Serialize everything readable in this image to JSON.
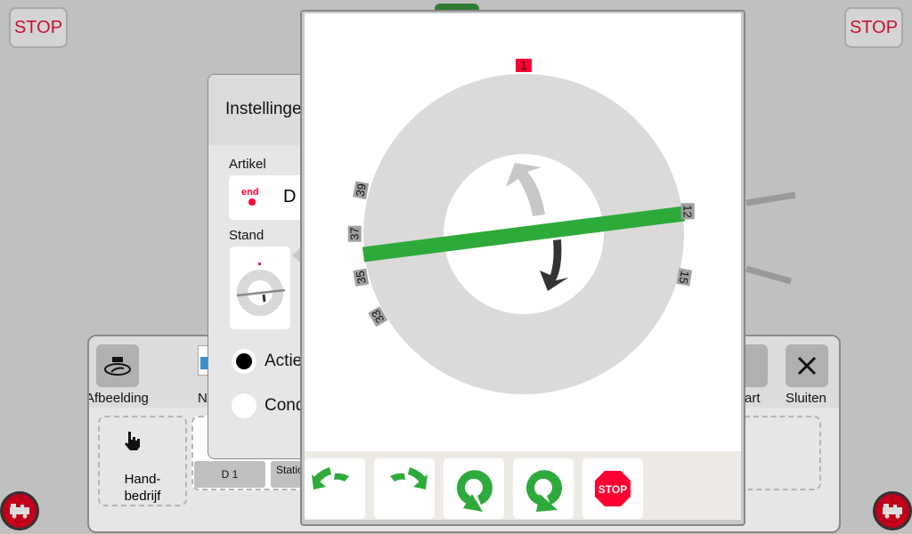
{
  "top": {
    "stop_left": "STOP",
    "stop_right": "STOP"
  },
  "panel": {
    "toolbar": [
      {
        "label": "Afbeelding",
        "icon": "turntable-icon"
      },
      {
        "label": "N",
        "icon": "name-icon"
      },
      {
        "label": "art",
        "icon": "start-icon"
      },
      {
        "label": "Sluiten",
        "icon": "close-icon"
      }
    ],
    "hand_bedrijf": "Hand-\nbedrijf",
    "tabs": [
      "D 1",
      "Statio"
    ]
  },
  "settings": {
    "title": "Instellinge",
    "artikel_label": "Artikel",
    "artikel_value": "D",
    "artikel_icon_text": "end",
    "stand_label": "Stand",
    "options": [
      {
        "label": "Actie",
        "selected": true
      },
      {
        "label": "Cond",
        "selected": false
      }
    ]
  },
  "turntable": {
    "active_track": "1",
    "track_labels": [
      "39",
      "37",
      "35",
      "33",
      "12",
      "15"
    ],
    "colors": {
      "bridge": "#2eaa3a",
      "active": "#ff0033",
      "ring": "#dadada"
    }
  },
  "controls": [
    {
      "name": "step-left",
      "icon": "rotate-step-left-icon"
    },
    {
      "name": "step-right",
      "icon": "rotate-step-right-icon"
    },
    {
      "name": "turn-180-a",
      "icon": "turn-around-icon"
    },
    {
      "name": "turn-180-b",
      "icon": "turn-around-icon"
    },
    {
      "name": "stop",
      "icon": "stop-sign-icon",
      "label": "STOP"
    }
  ]
}
